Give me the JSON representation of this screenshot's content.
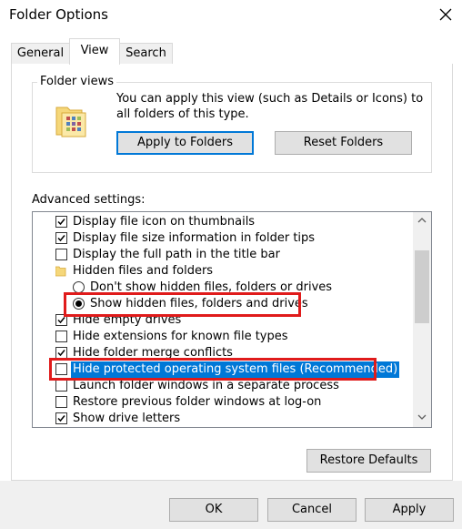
{
  "window": {
    "title": "Folder Options"
  },
  "tabs": [
    {
      "label": "General"
    },
    {
      "label": "View"
    },
    {
      "label": "Search"
    }
  ],
  "folder_views": {
    "legend": "Folder views",
    "description": "You can apply this view (such as Details or Icons) to all folders of this type.",
    "apply_label": "Apply to Folders",
    "reset_label": "Reset Folders"
  },
  "advanced": {
    "label": "Advanced settings:",
    "items": [
      {
        "kind": "checkbox",
        "label": "Display file icon on thumbnails",
        "checked": true
      },
      {
        "kind": "checkbox",
        "label": "Display file size information in folder tips",
        "checked": true
      },
      {
        "kind": "checkbox",
        "label": "Display the full path in the title bar",
        "checked": false
      },
      {
        "kind": "folder",
        "label": "Hidden files and folders"
      },
      {
        "kind": "radio",
        "label": "Don't show hidden files, folders or drives",
        "checked": false
      },
      {
        "kind": "radio",
        "label": "Show hidden files, folders and drives",
        "checked": true
      },
      {
        "kind": "checkbox",
        "label": "Hide empty drives",
        "checked": true
      },
      {
        "kind": "checkbox",
        "label": "Hide extensions for known file types",
        "checked": false
      },
      {
        "kind": "checkbox",
        "label": "Hide folder merge conflicts",
        "checked": true
      },
      {
        "kind": "checkbox",
        "label": "Hide protected operating system files (Recommended)",
        "checked": false,
        "selected": true
      },
      {
        "kind": "checkbox",
        "label": "Launch folder windows in a separate process",
        "checked": false
      },
      {
        "kind": "checkbox",
        "label": "Restore previous folder windows at log-on",
        "checked": false
      },
      {
        "kind": "checkbox",
        "label": "Show drive letters",
        "checked": true
      }
    ],
    "restore_label": "Restore Defaults"
  },
  "footer": {
    "ok_label": "OK",
    "cancel_label": "Cancel",
    "apply_label": "Apply"
  },
  "colors": {
    "accent": "#0078d7",
    "highlight": "#e01b1b"
  }
}
